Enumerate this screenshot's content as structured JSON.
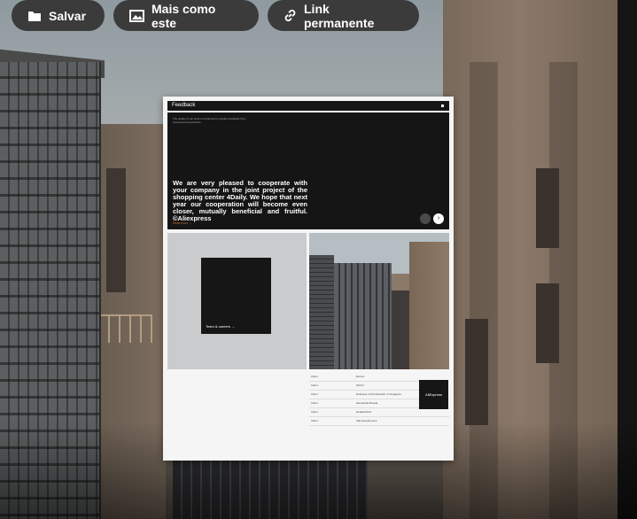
{
  "toolbar": {
    "save_label": "Salvar",
    "more_like_this_label": "Mais como este",
    "permalink_label": "Link permanente"
  },
  "preview": {
    "header_title": "Feedback",
    "hero_small_text": "The quality of our work is confirmed by positive feedback from customers and partners.",
    "hero_quote": "We are very pleased to cooperate with your company in the joint project of the shopping center 4Daily. We hope that next year our cooperation will become even closer, mutually beneficial and fruitful. ©Aliexpress",
    "read_more": "Read more →",
    "next_arrow": "›",
    "team_tile_label": "Team & careers →",
    "aliexpress_badge": "AliExpress",
    "clients_table": [
      {
        "type": "Client",
        "name": "Ecorex"
      },
      {
        "type": "Client",
        "name": "NOCC"
      },
      {
        "type": "Client",
        "name": "Embassy of the Republic of Singapore"
      },
      {
        "type": "Client",
        "name": "Alexandria Russia"
      },
      {
        "type": "Client",
        "name": "Headsetfrind"
      },
      {
        "type": "Client",
        "name": "Sab-development"
      }
    ]
  },
  "icons": {
    "save": "folder-icon",
    "more_like_this": "image-icon",
    "permalink": "link-icon"
  },
  "colors": {
    "pill_background": "#3b3b3b",
    "pill_text": "#ffffff",
    "accent_orange": "#c9702b"
  }
}
